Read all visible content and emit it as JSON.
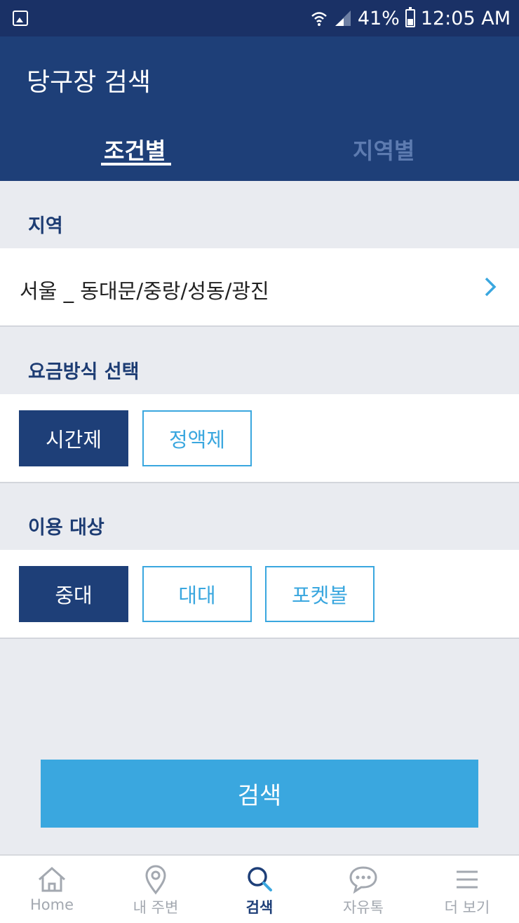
{
  "status_bar": {
    "battery": "41%",
    "time": "12:05 AM"
  },
  "header": {
    "title": "당구장 검색",
    "tabs": [
      {
        "label": "조건별",
        "active": true
      },
      {
        "label": "지역별",
        "active": false
      }
    ]
  },
  "region": {
    "label": "지역",
    "value": "서울 _ 동대문/중랑/성동/광진"
  },
  "fee": {
    "label": "요금방식 선택",
    "options": [
      {
        "label": "시간제",
        "selected": true
      },
      {
        "label": "정액제",
        "selected": false
      }
    ]
  },
  "target": {
    "label": "이용 대상",
    "options": [
      {
        "label": "중대",
        "selected": true
      },
      {
        "label": "대대",
        "selected": false
      },
      {
        "label": "포켓볼",
        "selected": false
      }
    ]
  },
  "search_button": "검색",
  "bottom_nav": [
    {
      "label": "Home",
      "icon": "home-icon",
      "active": false
    },
    {
      "label": "내 주변",
      "icon": "location-pin-icon",
      "active": false
    },
    {
      "label": "검색",
      "icon": "search-icon",
      "active": true
    },
    {
      "label": "자유톡",
      "icon": "chat-bubble-icon",
      "active": false
    },
    {
      "label": "더 보기",
      "icon": "menu-icon",
      "active": false
    }
  ],
  "colors": {
    "header": "#1e3f78",
    "status_bar": "#1a3166",
    "accent": "#3aa7df",
    "section_label": "#1d3c73",
    "background": "#e9ebf0"
  }
}
